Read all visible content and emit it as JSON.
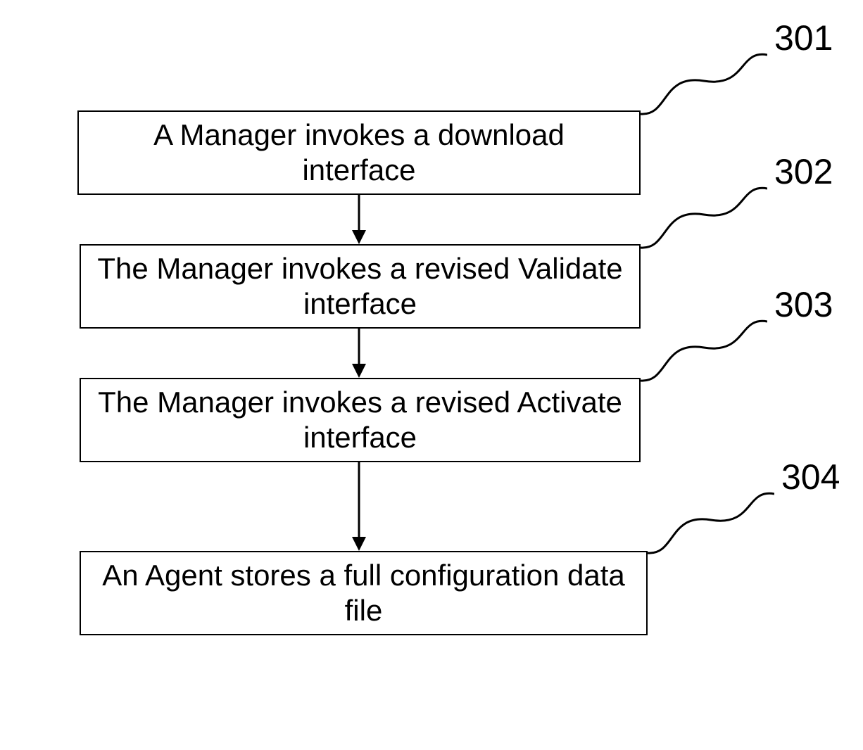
{
  "chart_data": {
    "type": "flowchart",
    "title": "",
    "steps": [
      {
        "id": "301",
        "text": "A Manager invokes a download interface"
      },
      {
        "id": "302",
        "text": "The Manager invokes a revised Validate interface"
      },
      {
        "id": "303",
        "text": "The Manager invokes a revised Activate interface"
      },
      {
        "id": "304",
        "text": "An Agent stores a full configuration data file"
      }
    ],
    "edges": [
      {
        "from": "301",
        "to": "302"
      },
      {
        "from": "302",
        "to": "303"
      },
      {
        "from": "303",
        "to": "304"
      }
    ]
  },
  "steps": {
    "s301": {
      "label": "301",
      "text": "A Manager invokes a download interface"
    },
    "s302": {
      "label": "302",
      "text": "The Manager invokes a revised Validate interface"
    },
    "s303": {
      "label": "303",
      "text": "The Manager invokes a revised Activate interface"
    },
    "s304": {
      "label": "304",
      "text": "An Agent stores a full configuration data file"
    }
  }
}
